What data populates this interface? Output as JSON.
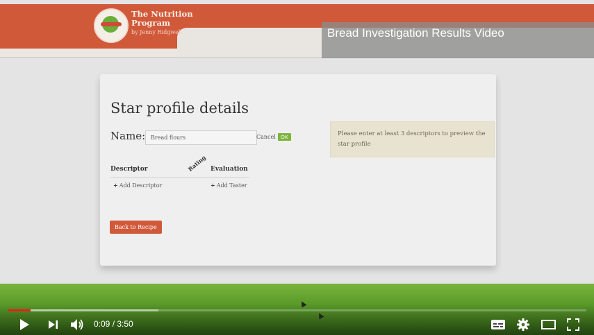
{
  "logo": {
    "title_line1": "The Nutrition",
    "title_line2": "Program",
    "subtitle": "by Jenny Ridgwell"
  },
  "video": {
    "title": "Bread Investigation Results Video"
  },
  "card": {
    "title": "Star profile details",
    "name_label": "Name:",
    "name_value": "Bread flours",
    "cancel_label": "Cancel",
    "ok_label": "OK",
    "columns": {
      "descriptor": "Descriptor",
      "rating": "Rating",
      "evaluation": "Evaluation"
    },
    "add_descriptor": "Add Descriptor",
    "add_taster": "Add Taster",
    "back_label": "Back to Recipe",
    "notice": "Please enter at least 3 descriptors to preview the star profile"
  },
  "player": {
    "current_time": "0:09",
    "duration": "3:50",
    "time_text": "0:09 / 3:50",
    "played_fraction": 0.039,
    "buffered_fraction": 0.26,
    "icons": [
      "play-icon",
      "next-icon",
      "volume-icon",
      "subtitles-icon",
      "settings-icon",
      "theater-icon",
      "fullscreen-icon"
    ],
    "colors": {
      "progress": "#e62117"
    }
  },
  "colors": {
    "brand": "#d0593a",
    "ok": "#7db53c"
  }
}
